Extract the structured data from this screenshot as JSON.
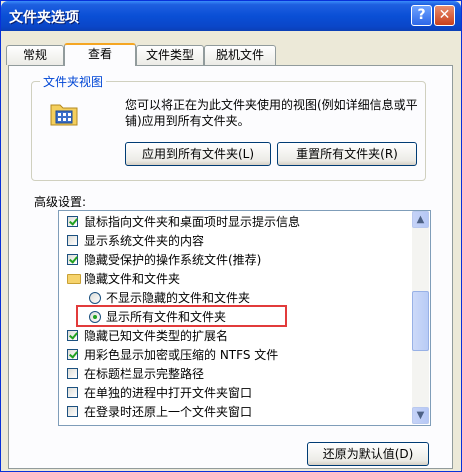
{
  "window": {
    "title": "文件夹选项",
    "help_symbol": "?",
    "close_symbol": "✕"
  },
  "tabs": [
    {
      "label": "常规",
      "active": false
    },
    {
      "label": "查看",
      "active": true
    },
    {
      "label": "文件类型",
      "active": false
    },
    {
      "label": "脱机文件",
      "active": false
    }
  ],
  "folder_views": {
    "title": "文件夹视图",
    "icon": "folder-view-icon",
    "description": "您可以将正在为此文件夹使用的视图(例如详细信息或平铺)应用到所有文件夹。",
    "apply_all_label": "应用到所有文件夹(L)",
    "reset_all_label": "重置所有文件夹(R)"
  },
  "advanced": {
    "label": "高级设置:",
    "items": [
      {
        "type": "checkbox",
        "checked": true,
        "label": "鼠标指向文件夹和桌面项时显示提示信息"
      },
      {
        "type": "checkbox",
        "checked": false,
        "label": "显示系统文件夹的内容"
      },
      {
        "type": "checkbox",
        "checked": true,
        "label": "隐藏受保护的操作系统文件(推荐)"
      },
      {
        "type": "folder",
        "label": "隐藏文件和文件夹"
      },
      {
        "type": "radio",
        "checked": false,
        "label": "不显示隐藏的文件和文件夹"
      },
      {
        "type": "radio",
        "checked": true,
        "label": "显示所有文件和文件夹"
      },
      {
        "type": "checkbox",
        "checked": true,
        "label": "隐藏已知文件类型的扩展名"
      },
      {
        "type": "checkbox",
        "checked": true,
        "label": "用彩色显示加密或压缩的 NTFS 文件"
      },
      {
        "type": "checkbox",
        "checked": false,
        "label": "在标题栏显示完整路径"
      },
      {
        "type": "checkbox",
        "checked": false,
        "label": "在单独的进程中打开文件夹窗口"
      },
      {
        "type": "checkbox",
        "checked": false,
        "label": "在登录时还原上一个文件夹窗口"
      }
    ]
  },
  "restore_defaults_label": "还原为默认值(D)",
  "colors": {
    "accent_red": "#e23b3b",
    "title_blue": "#0a4fd6"
  }
}
